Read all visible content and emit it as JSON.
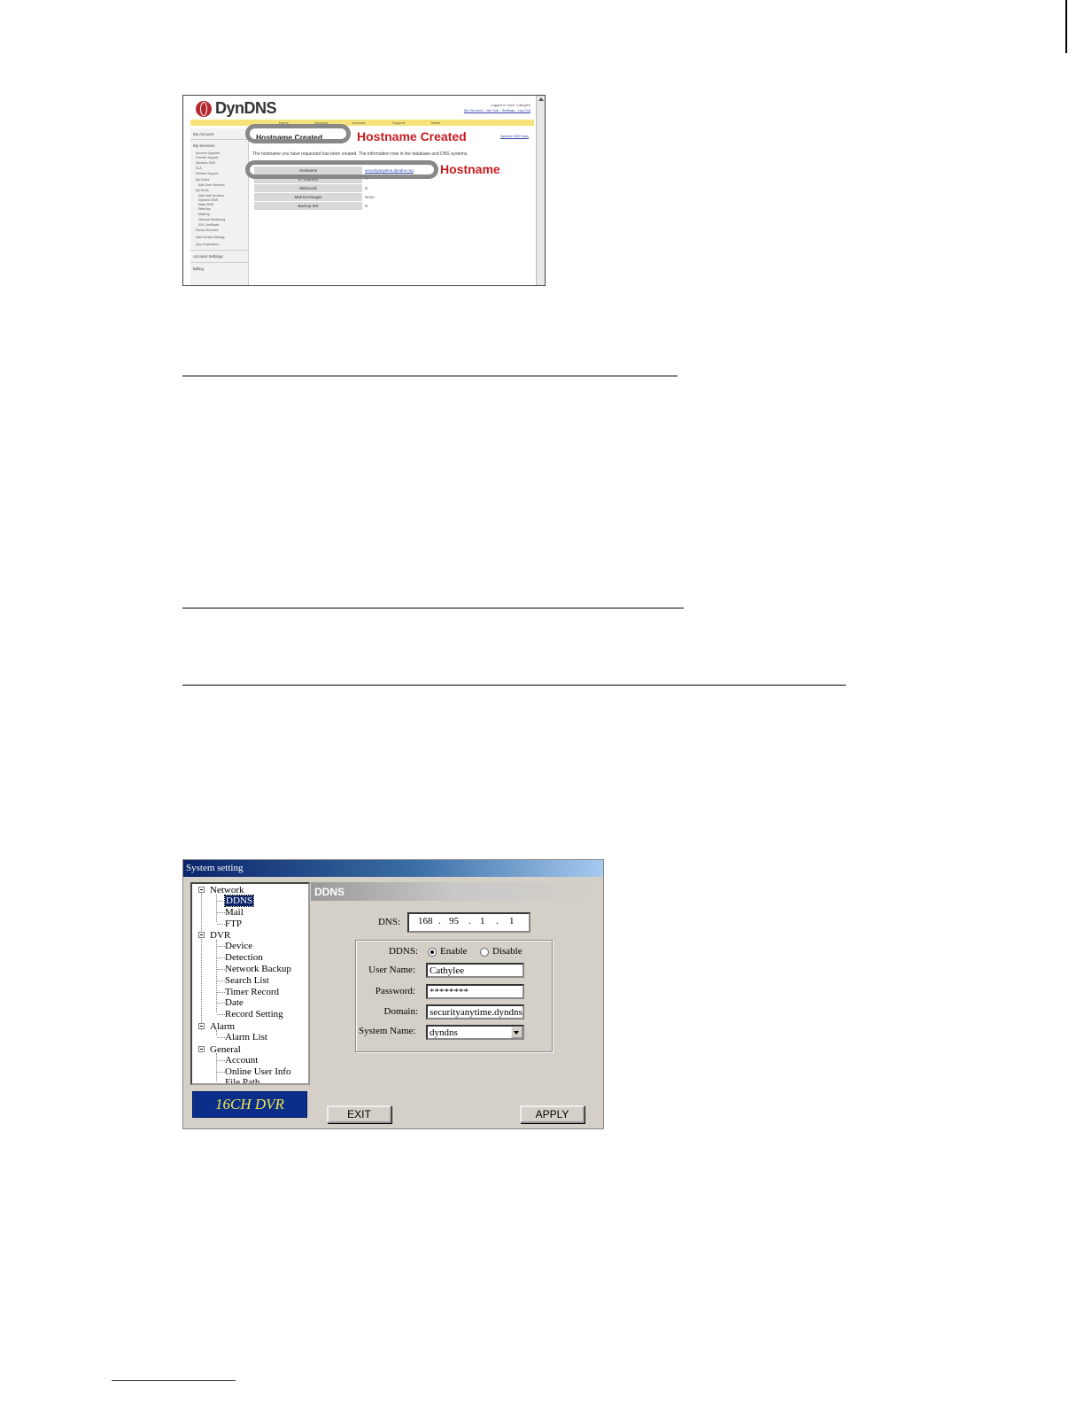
{
  "dyndns": {
    "logo": "DynDNS",
    "user_line": "Logged In User: Cathylee",
    "user_links": "My Services - My Cart - Settings - Log Out",
    "nav": [
      "Home",
      "Services",
      "Account",
      "Support",
      "News"
    ],
    "sidebar": {
      "my_account": "My Account",
      "my_services": "My Services",
      "items": [
        "Account Upgrade",
        "Premier Support",
        "Dynamic DNS",
        "SLA",
        "Premier Support",
        "My Zones",
        "Add Zone Services",
        "My Hosts",
        "Add Host Services",
        "Dynamic DNS",
        "Static DNS",
        "WebHop",
        "MailHop",
        "Network Monitoring",
        "SSL Certificate",
        "Renew Services",
        "Auto Renew Settings",
        "Sync Expirations"
      ],
      "account_settings": "Account Settings",
      "billing": "Billing"
    },
    "heading": "Hostname Created",
    "annotation_title": "Hostname Created",
    "acme_link": "Dynamic DNS Hosts",
    "description": "The hostname you have requested has been created. The information now in the database and DNS systems.",
    "table": [
      {
        "label": "Hostname",
        "value": "securityanytime.dyndns.org"
      },
      {
        "label": "IP Address",
        "value": "---"
      },
      {
        "label": "Wildcards",
        "value": "N"
      },
      {
        "label": "Mail Exchanger",
        "value": "None"
      },
      {
        "label": "Backup MX",
        "value": "N"
      }
    ],
    "annotation_hostname": "Hostname"
  },
  "system_setting": {
    "title": "System setting",
    "tree": [
      {
        "label": "Network",
        "children": [
          "DDNS",
          "Mail",
          "FTP"
        ]
      },
      {
        "label": "DVR",
        "children": [
          "Device",
          "Detection",
          "Network Backup",
          "Search List",
          "Timer Record",
          "Date",
          "Record Setting"
        ]
      },
      {
        "label": "Alarm",
        "children": [
          "Alarm List"
        ]
      },
      {
        "label": "General",
        "children": [
          "Account",
          "Online User Info",
          "File Path"
        ]
      }
    ],
    "selected": "DDNS",
    "brand": "16CH DVR",
    "panel_title": "DDNS",
    "dns_label": "DNS:",
    "dns_octets": [
      "168",
      "95",
      "1",
      "1"
    ],
    "ddns_label": "DDNS:",
    "enable_label": "Enable",
    "disable_label": "Disable",
    "ddns_enabled": true,
    "username_label": "User Name:",
    "username": "Cathylee",
    "password_label": "Password:",
    "password": "********",
    "domain_label": "Domain:",
    "domain": "securityanytime.dyndns.org",
    "system_name_label": "System Name:",
    "system_name": "dyndns",
    "exit_button": "EXIT",
    "apply_button": "APPLY"
  }
}
